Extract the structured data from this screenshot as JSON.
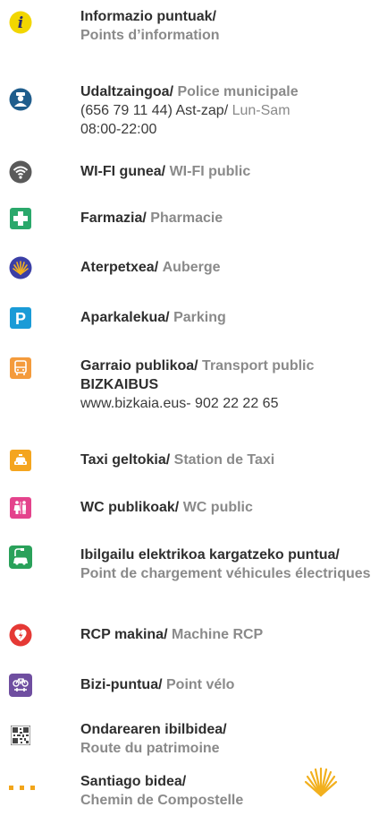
{
  "colors": {
    "info": "#f2d600",
    "police": "#1f5d8c",
    "wifi": "#5a5a5a",
    "pharmacy": "#2aa86b",
    "hostel": "#3b3fa6",
    "shell": "#f2b01e",
    "parking": "#1a9bd7",
    "transport": "#f49b3c",
    "taxi": "#f4a51f",
    "wc": "#e4438c",
    "ev": "#2aa15a",
    "rcp": "#e53935",
    "bike": "#6f4ea0",
    "qr": "#444444",
    "route": "#f2a51a"
  },
  "items": [
    {
      "icon": "info-icon",
      "main": "Informazio puntuak/",
      "fr": "Points d’information"
    },
    {
      "icon": "police-icon",
      "main": "Udaltzaingoa/",
      "fr": "Police municipale",
      "line2": "(656 79 11 44) Ast-zap/",
      "line2_fr": "Lun-Sam",
      "line3": "08:00-22:00"
    },
    {
      "icon": "wifi-icon",
      "main": "WI-FI gunea/",
      "fr": "WI-FI public"
    },
    {
      "icon": "pharmacy-cross-icon",
      "main": "Farmazia/",
      "fr": "Pharmacie"
    },
    {
      "icon": "scallop-shell-icon",
      "main": "Aterpetxea/",
      "fr": "Auberge"
    },
    {
      "icon": "parking-icon",
      "main": "Aparkalekua/",
      "fr": "Parking"
    },
    {
      "icon": "bus-icon",
      "main": "Garraio publikoa/",
      "fr": "Transport public",
      "extra": "BIZKAIBUS",
      "line2": "www.bizkaia.eus- 902 22 22 65"
    },
    {
      "icon": "taxi-icon",
      "main": "Taxi geltokia/",
      "fr": "Station de Taxi"
    },
    {
      "icon": "wc-icon",
      "main": "WC publikoak/",
      "fr": "WC public"
    },
    {
      "icon": "ev-charging-icon",
      "main": "Ibilgailu elektrikoa kargatzeko puntua/",
      "fr": "Point de chargement véhicules électriques"
    },
    {
      "icon": "defibrillator-icon",
      "main": "RCP makina/",
      "fr": "Machine RCP"
    },
    {
      "icon": "bike-icon",
      "main": "Bizi-puntua/",
      "fr": "Point vélo"
    },
    {
      "icon": "qr-code-icon",
      "main": "Ondarearen ibilbidea/",
      "fr": "Route du patrimoine"
    },
    {
      "icon": "dashed-route-icon",
      "main": "Santiago bidea/",
      "fr": "Chemin de Compostelle"
    }
  ],
  "info_glyph": "i",
  "parking_glyph": "P"
}
